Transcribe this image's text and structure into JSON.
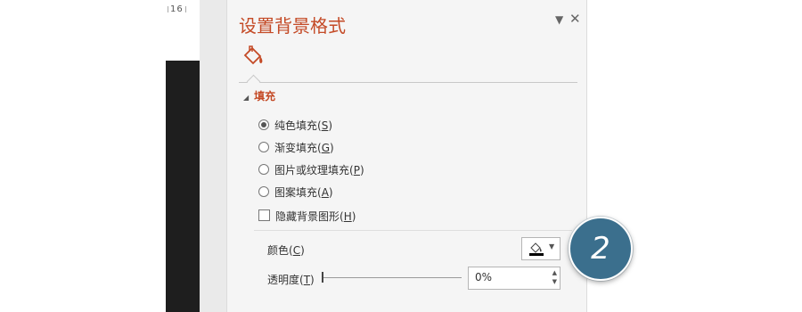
{
  "ruler": {
    "number": "16"
  },
  "panel": {
    "title": "设置背景格式",
    "dropdown_icon": "chevron-down-icon",
    "close_glyph": "✕",
    "tab_icon": "paint-bucket-icon"
  },
  "fill": {
    "section_label": "填充",
    "options": [
      {
        "text": "纯色填充(",
        "key": "S",
        "end": ")",
        "selected": true
      },
      {
        "text": "渐变填充(",
        "key": "G",
        "end": ")",
        "selected": false
      },
      {
        "text": "图片或纹理填充(",
        "key": "P",
        "end": ")",
        "selected": false
      },
      {
        "text": "图案填充(",
        "key": "A",
        "end": ")",
        "selected": false
      }
    ],
    "hide_graphics": {
      "text": "隐藏背景图形(",
      "key": "H",
      "end": ")",
      "checked": false
    },
    "color": {
      "text": "颜色(",
      "key": "C",
      "end": ")",
      "swatch": "#000000"
    },
    "transparency": {
      "text": "透明度(",
      "key": "T",
      "end": ")",
      "value": "0%"
    }
  },
  "callout": {
    "number": "2",
    "color": "#3b6f8d"
  },
  "colors": {
    "accent": "#c44a26",
    "panel_bg": "#f5f5f5"
  }
}
